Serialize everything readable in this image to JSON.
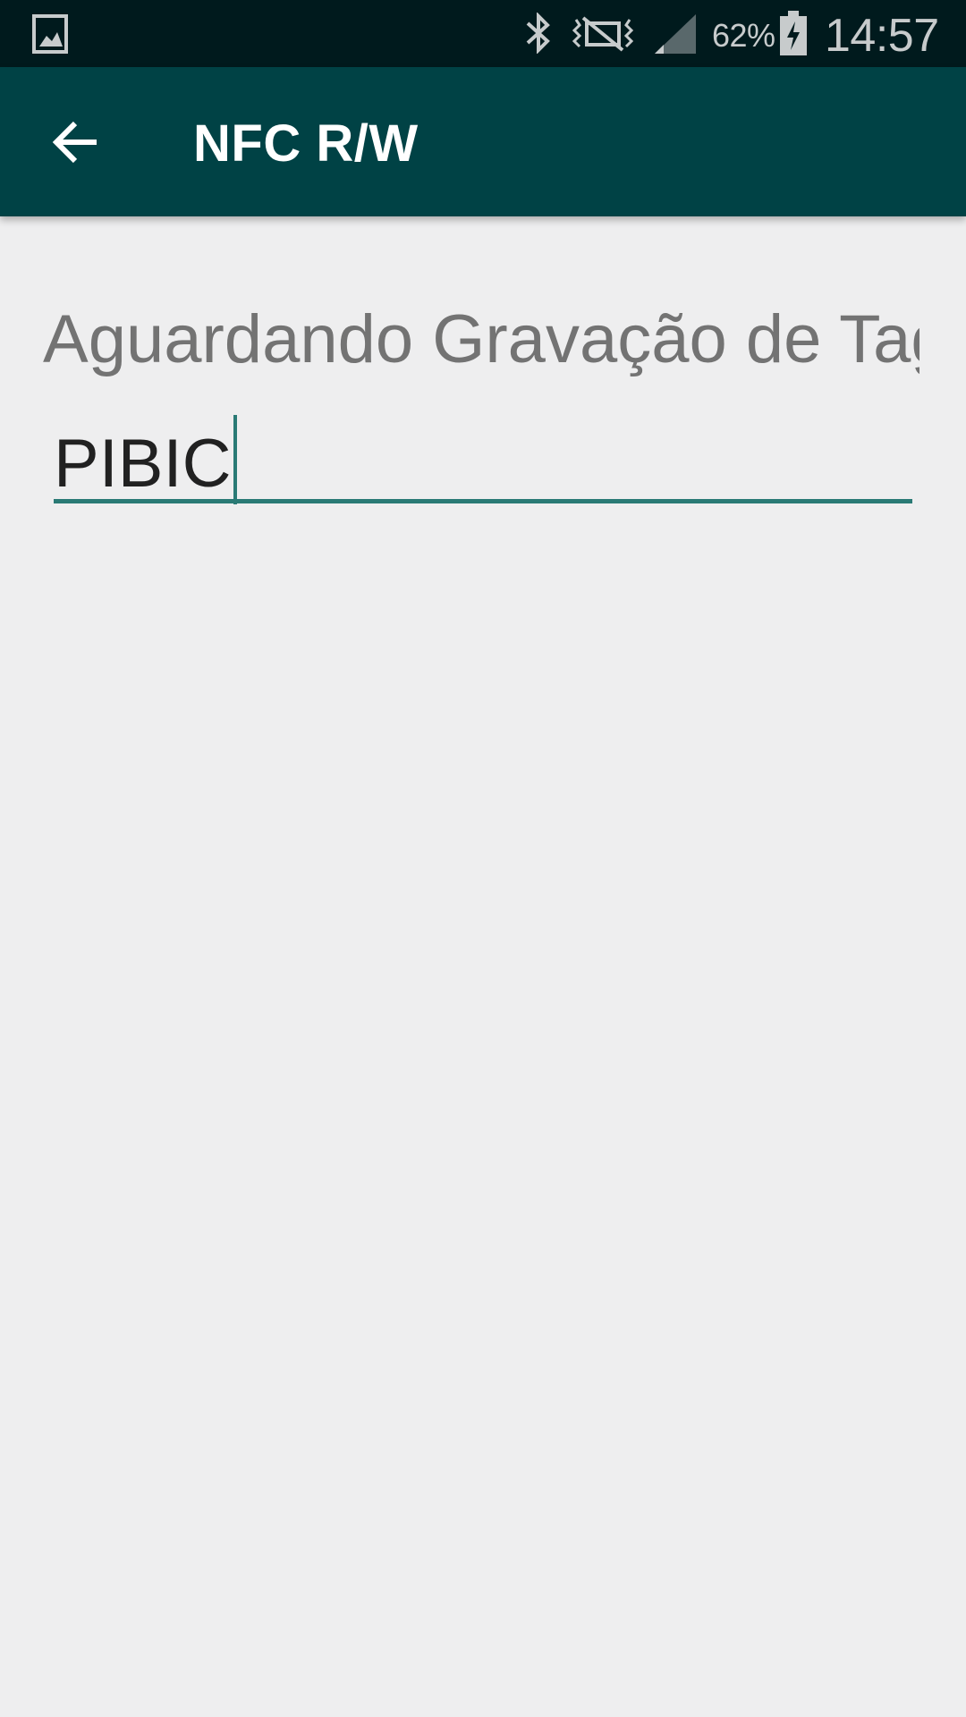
{
  "status_bar": {
    "battery_percent": "62%",
    "time": "14:57",
    "icons": [
      "gallery-icon",
      "bluetooth-icon",
      "vibrate-mute-icon",
      "signal-icon",
      "battery-charging-icon"
    ]
  },
  "toolbar": {
    "title": "NFC R/W",
    "back_icon": "arrow-back-icon",
    "background_color": "#004245"
  },
  "content": {
    "status_label": "Aguardando Gravação de Tag",
    "tag_input": {
      "value": "PIBIC"
    },
    "accent_color": "#2a7a75",
    "background_color": "#eeeeef"
  }
}
